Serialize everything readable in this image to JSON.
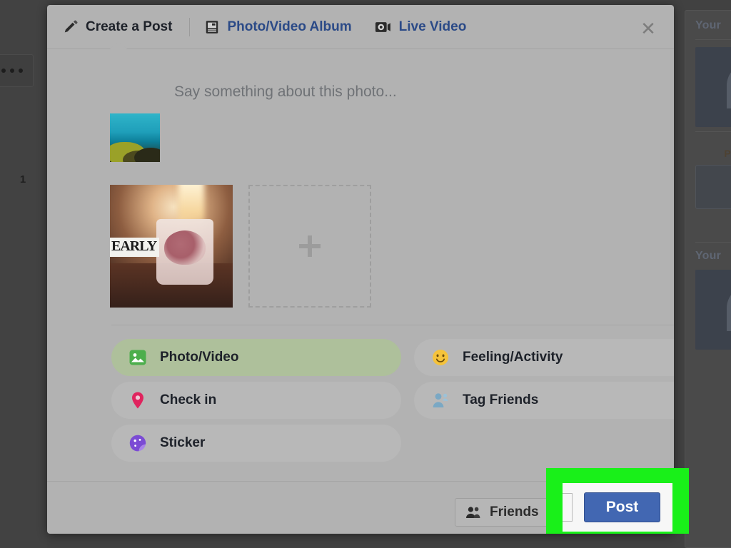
{
  "background": {
    "overlay_color": "#414141",
    "left_rail": {
      "more_button_icon": "ellipsis-icon",
      "count_label": "1"
    },
    "right_sidebar": {
      "heading_1": "Your",
      "sub_label": "P",
      "heading_2": "Your"
    }
  },
  "dialog": {
    "tabs": [
      {
        "label": "Create a Post",
        "icon": "pencil-icon",
        "active": true
      },
      {
        "label": "Photo/Video Album",
        "icon": "photo-album-icon",
        "active": false
      },
      {
        "label": "Live Video",
        "icon": "live-video-icon",
        "active": false
      }
    ],
    "close_icon": "close-icon",
    "compose": {
      "placeholder": "Say something about this photo...",
      "avatar_icon": "user-avatar-underwater-photo",
      "emoji_icon": "smiley-face-icon"
    },
    "attachments": {
      "photo_icon": "attached-photo-candle-jar",
      "photo_overlay_text": "EARLY",
      "add_more_icon": "plus-icon"
    },
    "options": [
      {
        "label": "Photo/Video",
        "icon": "photo-video-icon",
        "color": "#4cae4c",
        "active": true
      },
      {
        "label": "Feeling/Activity",
        "icon": "feeling-smiley-icon",
        "color": "#f5c33b",
        "active": false
      },
      {
        "label": "Check in",
        "icon": "location-pin-icon",
        "color": "#e0245e",
        "active": false
      },
      {
        "label": "Tag Friends",
        "icon": "tag-friends-icon",
        "color": "#7aa8c4",
        "active": false
      },
      {
        "label": "Sticker",
        "icon": "sticker-icon",
        "color": "#7b4bd4",
        "active": false
      }
    ],
    "footer": {
      "audience_label": "Friends",
      "audience_icon": "friends-group-icon",
      "post_label": "Post",
      "post_color": "#4267b2"
    }
  },
  "annotation": {
    "highlight_color": "#19f019",
    "highlighted_label": "Post"
  }
}
